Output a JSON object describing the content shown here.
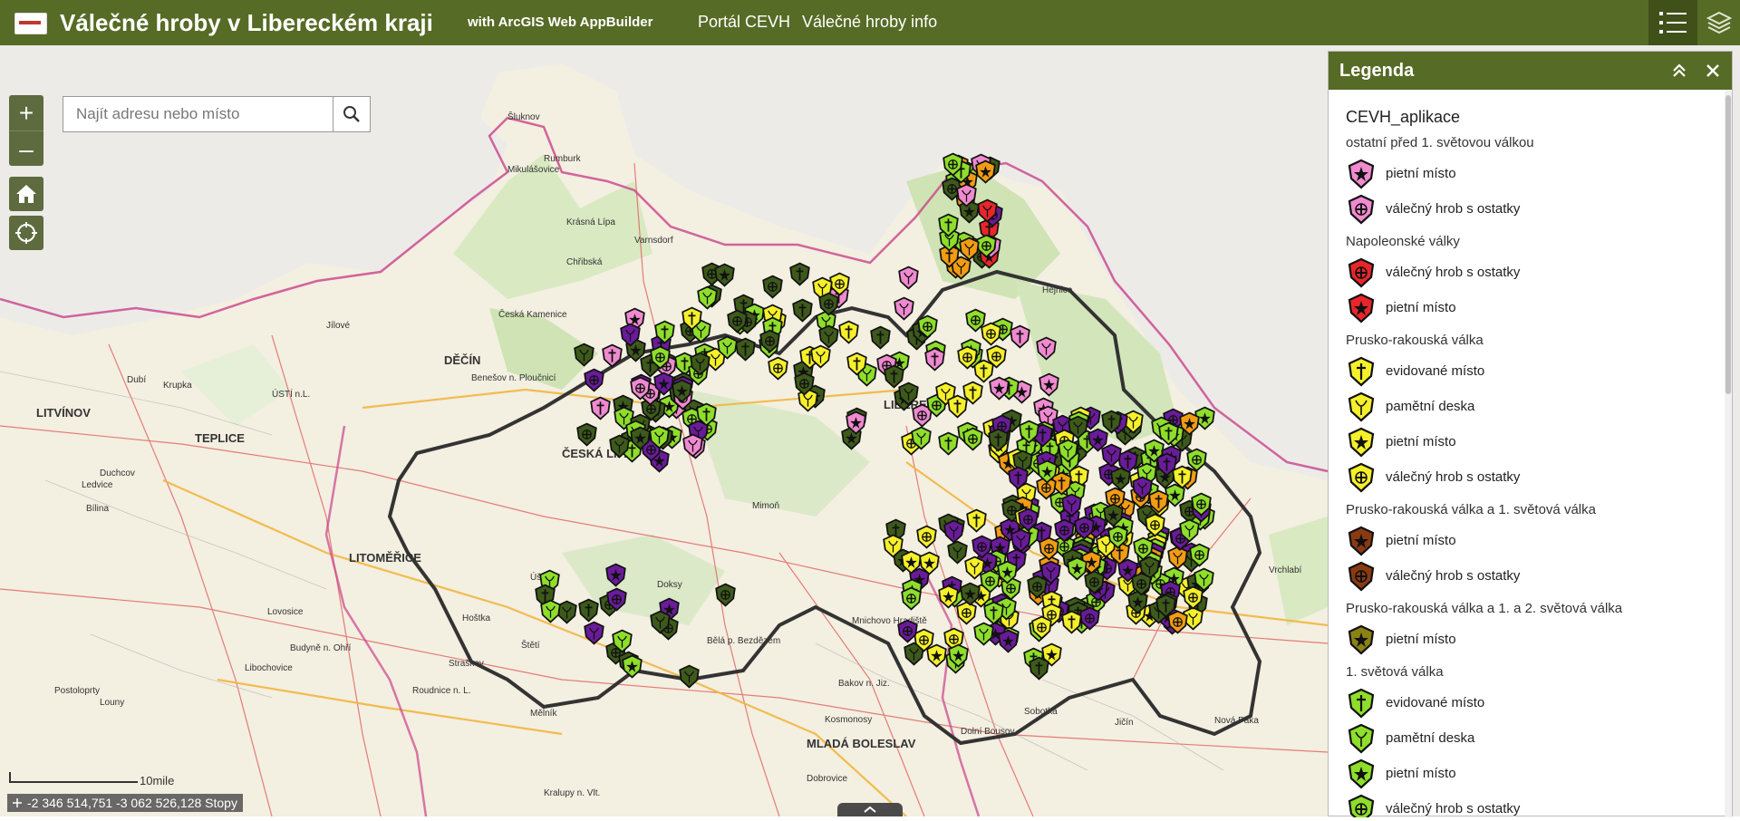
{
  "header": {
    "title": "Válečné hroby v Libereckém kraji",
    "subtitle": "with ArcGIS Web AppBuilder",
    "links": [
      "Portál CEVH",
      "Válečné hroby info"
    ]
  },
  "search": {
    "placeholder": "Najít adresu nebo místo"
  },
  "status": {
    "coordinates": "-2 346 514,751 -3 062 526,128 Stopy",
    "scale_label": "10mile"
  },
  "map": {
    "place_labels": [
      "Šluknov",
      "Rumburk",
      "Varnsdorf",
      "Mikulášovice",
      "Krásná Lípa",
      "Chřibská",
      "Česká Kamenice",
      "Jílové",
      "DĚČÍN",
      "Krupka",
      "Dubí",
      "ÚSTÍ n.L.",
      "LITVÍNOV",
      "TEPLICE",
      "Duchcov",
      "Ledvice",
      "Bílina",
      "Benešov n. Ploučnicí",
      "ČESKÁ LÍPA",
      "Mimoň",
      "Doksy",
      "LITOMĚŘICE",
      "Lovosice",
      "Štětí",
      "Roudnice n. L.",
      "Mělník",
      "MLADÁ BOLESLAV",
      "Mnichovo Hradiště",
      "Bakov n. Jiz.",
      "Kosmonosy",
      "Dobrovice",
      "Bělá p. Bezdězem",
      "LIBEREC",
      "Hejnice",
      "Nová Paka",
      "Jičín",
      "Vrchlabí",
      "Sobotka",
      "Dolní Bousov",
      "Louny",
      "Postoloprty",
      "Budyně n. Ohří",
      "Libochovice",
      "Straškov",
      "Kralupy n. Vlt.",
      "Úštěk",
      "Hoštka"
    ]
  },
  "legend": {
    "title": "Legenda",
    "layer": "CEVH_aplikace",
    "groups": [
      {
        "name": "ostatní před 1. světovou válkou",
        "items": [
          {
            "label": "pietní místo",
            "icon": "star-shield",
            "color": "#f08ad0"
          },
          {
            "label": "válečný hrob s ostatky",
            "icon": "cross-shield",
            "color": "#f08ad0"
          }
        ]
      },
      {
        "name": "Napoleonské války",
        "items": [
          {
            "label": "válečný hrob s ostatky",
            "icon": "cross-shield",
            "color": "#e8262a"
          },
          {
            "label": "pietní místo",
            "icon": "star-shield",
            "color": "#e8262a"
          }
        ]
      },
      {
        "name": "Prusko-rakouská válka",
        "items": [
          {
            "label": "evidované místo",
            "icon": "plain-cross-shield",
            "color": "#f5f02a"
          },
          {
            "label": "pamětní deska",
            "icon": "leaf-shield",
            "color": "#f5f02a"
          },
          {
            "label": "pietní místo",
            "icon": "star-shield",
            "color": "#f5f02a"
          },
          {
            "label": "válečný hrob s ostatky",
            "icon": "cross-shield",
            "color": "#f5f02a"
          }
        ]
      },
      {
        "name": "Prusko-rakouská válka a 1. světová válka",
        "items": [
          {
            "label": "pietní místo",
            "icon": "star-shield",
            "color": "#8a3a12"
          },
          {
            "label": "válečný hrob s ostatky",
            "icon": "cross-shield",
            "color": "#8a3a12"
          }
        ]
      },
      {
        "name": "Prusko-rakouská válka a 1. a 2. světová válka",
        "items": [
          {
            "label": "pietní místo",
            "icon": "star-shield",
            "color": "#8b8216"
          }
        ]
      },
      {
        "name": "1. světová válka",
        "items": [
          {
            "label": "evidované místo",
            "icon": "plain-cross-shield",
            "color": "#8ede2a"
          },
          {
            "label": "pamětní deska",
            "icon": "leaf-shield",
            "color": "#8ede2a"
          },
          {
            "label": "pietní místo",
            "icon": "star-shield",
            "color": "#8ede2a"
          },
          {
            "label": "válečný hrob s ostatky",
            "icon": "cross-shield",
            "color": "#8ede2a"
          }
        ]
      }
    ]
  },
  "colors": {
    "header": "#566b25",
    "light_green": "#8ede2a",
    "dark_green": "#3d5a1a",
    "purple": "#6a1b9a",
    "yellow": "#f5f02a",
    "pink": "#f08ad0",
    "red": "#e8262a",
    "orange": "#f39c12"
  }
}
